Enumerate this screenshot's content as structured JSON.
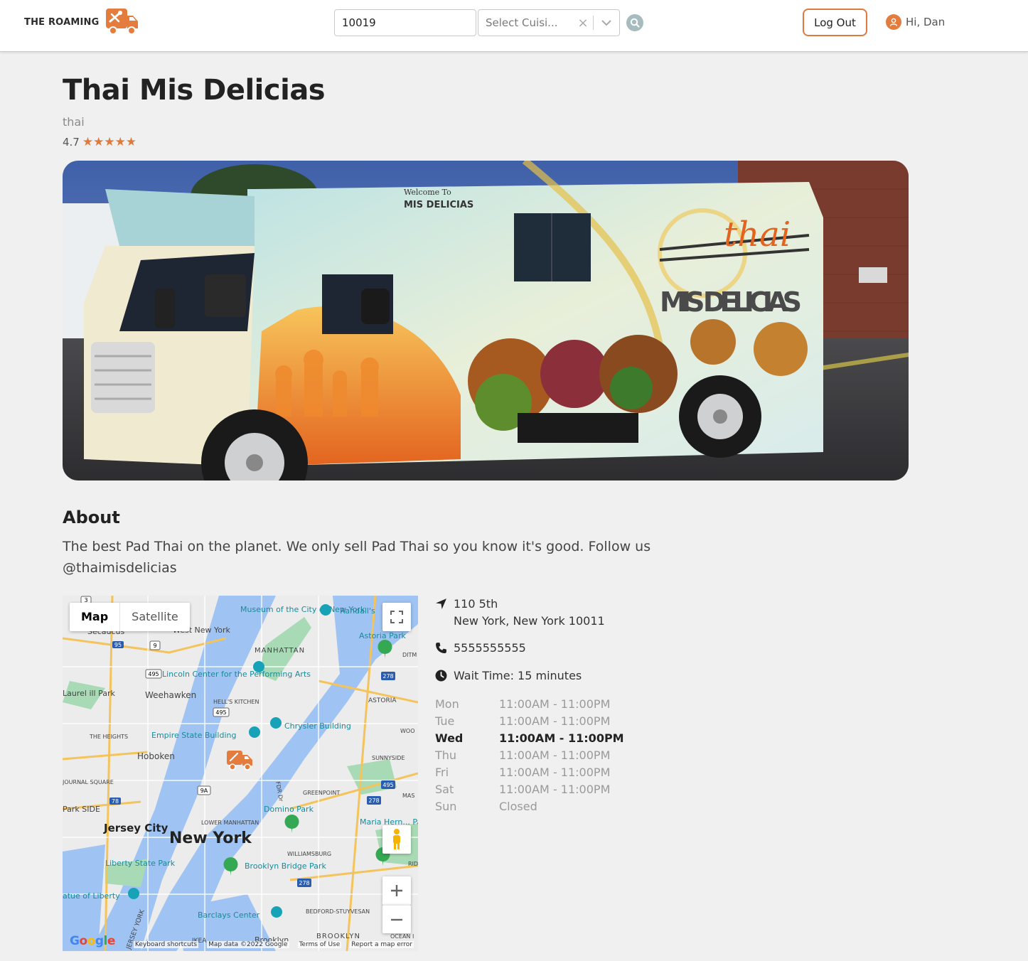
{
  "header": {
    "logo_text": "THE ROAMING",
    "zip_value": "10019",
    "cuisine_placeholder": "Select Cuisi...",
    "clear_glyph": "×",
    "logout_label": "Log Out",
    "greeting": "Hi, Dan",
    "accent_color": "#e07a3c"
  },
  "truck": {
    "name": "Thai Mis Delicias",
    "cuisine": "thai",
    "rating": "4.7",
    "rating_stars": 4.7
  },
  "hero_image": {
    "sign_script": "thai",
    "sign_name": "MIS DELICIAS",
    "welcome": "Welcome To",
    "welcome_name": "MIS DELICIAS"
  },
  "about": {
    "heading": "About",
    "text": "The best Pad Thai on the planet. We only sell Pad Thai so you know it's good. Follow us @thaimisdelicias"
  },
  "map": {
    "tab_map": "Map",
    "tab_satellite": "Satellite",
    "labels": {
      "new_york": "New York",
      "manhattan": "MANHATTAN",
      "jersey_city": "Jersey City",
      "hoboken": "Hoboken",
      "weehawken": "Weehawken",
      "west_new_york": "West New York",
      "astoria": "ASTORIA",
      "astoria_park": "Astoria Park",
      "secaucus": "Secaucus",
      "museum": "Museum of the City of New York",
      "randalls": "Randall's",
      "lincoln": "Lincoln Center for the Performing Arts",
      "hells_kitchen": "HELL'S KITCHEN",
      "empire": "Empire State Building",
      "chrysler": "Chrysler Building",
      "the_heights": "THE HEIGHTS",
      "journal_square": "JOURNAL SQUARE",
      "sunnyside": "SUNNYSIDE",
      "greenpoint": "GREENPOINT",
      "lower_manhattan": "LOWER MANHATTAN",
      "domino": "Domino Park",
      "williamsburg": "WILLIAMSBURG",
      "liberty_park": "Liberty State Park",
      "statue": "atue of Liberty",
      "brooklyn_bridge": "Brooklyn Bridge Park",
      "barclays": "Barclays Center",
      "bedford": "BEDFORD-STUYVESAN",
      "brooklyn": "BROOKLYN",
      "brooklyn2": "Brooklyn",
      "maria": "Maria Hern... Pa",
      "laurel": "Laurel ill Park",
      "park_side": "Park SIDE",
      "ditm": "DITM STEI",
      "woo": "WOO",
      "mas": "MAS",
      "rid": "RID",
      "ocean": "OCEAN I",
      "ikea": "IKEA",
      "jersey": "JERSEY YORK",
      "fdr": "FDR Dr"
    },
    "road_shields": [
      "3",
      "95",
      "9",
      "495",
      "495",
      "278",
      "9A",
      "78",
      "278",
      "495",
      "278"
    ],
    "google_letters": [
      "G",
      "o",
      "o",
      "g",
      "l",
      "e"
    ],
    "footer": {
      "shortcuts": "Keyboard shortcuts",
      "data": "Map data ©2022 Google",
      "terms": "Terms of Use",
      "report": "Report a map error"
    }
  },
  "info": {
    "address_line1": "110 5th",
    "address_line2": "New York, New York 10011",
    "phone": "5555555555",
    "wait": "Wait Time: 15 minutes"
  },
  "hours": [
    {
      "day": "Mon",
      "time": "11:00AM - 11:00PM",
      "today": false
    },
    {
      "day": "Tue",
      "time": "11:00AM - 11:00PM",
      "today": false
    },
    {
      "day": "Wed",
      "time": "11:00AM - 11:00PM",
      "today": true
    },
    {
      "day": "Thu",
      "time": "11:00AM - 11:00PM",
      "today": false
    },
    {
      "day": "Fri",
      "time": "11:00AM - 11:00PM",
      "today": false
    },
    {
      "day": "Sat",
      "time": "11:00AM - 11:00PM",
      "today": false
    },
    {
      "day": "Sun",
      "time": "Closed",
      "today": false
    }
  ]
}
